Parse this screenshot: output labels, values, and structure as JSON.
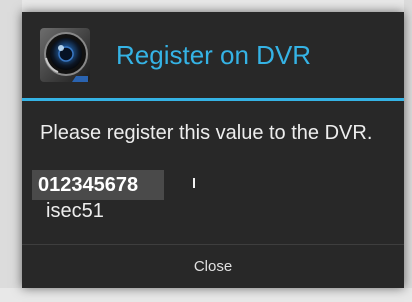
{
  "dialog": {
    "title": "Register on DVR",
    "message": "Please register this value to the DVR.",
    "registration_value": "012345678",
    "secondary_value": "isec51",
    "close_label": "Close",
    "accent_color": "#35b3e5",
    "background_color": "#282828",
    "icon": "dvr-camera-lens-icon"
  }
}
